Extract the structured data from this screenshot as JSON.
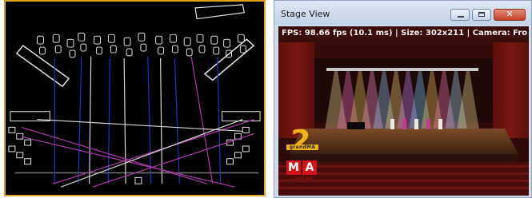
{
  "wireframe": {
    "panel": "3d-wireframe-stage-layout",
    "accent_color": "#e1a21e",
    "beam_colors": {
      "blue": "#2233cc",
      "magenta": "#b03ab0",
      "white": "#d8d8d8"
    }
  },
  "stage_window": {
    "title": "Stage View",
    "status_line": "FPS: 98.66 fps (10.1 ms) | Size: 302x211 | Camera: Fro",
    "buttons": {
      "minimize": "minimize-icon",
      "maximize": "maximize-icon",
      "close_glyph": "✕"
    },
    "logo": {
      "digit": "2",
      "word": "grandMA",
      "m": "M",
      "a": "A",
      "tagline": "LIGHTING"
    }
  }
}
